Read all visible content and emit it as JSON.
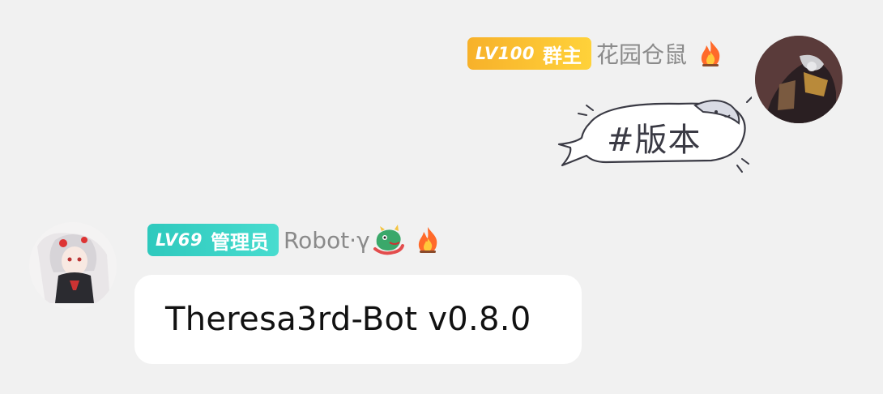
{
  "messages": [
    {
      "side": "right",
      "level": "LV100",
      "role": "群主",
      "nickname": "花园仓鼠",
      "role_color": "#f7b12a",
      "content_type": "sticker",
      "sticker_text": "#版本",
      "icons": [
        "fire-icon"
      ]
    },
    {
      "side": "left",
      "level": "LV69",
      "role": "管理员",
      "nickname": "Robot·γ",
      "role_color": "#2ec9bd",
      "content_type": "text",
      "text": "Theresa3rd-Bot v0.8.0",
      "icons": [
        "dragon-icon",
        "fire-icon"
      ]
    }
  ]
}
